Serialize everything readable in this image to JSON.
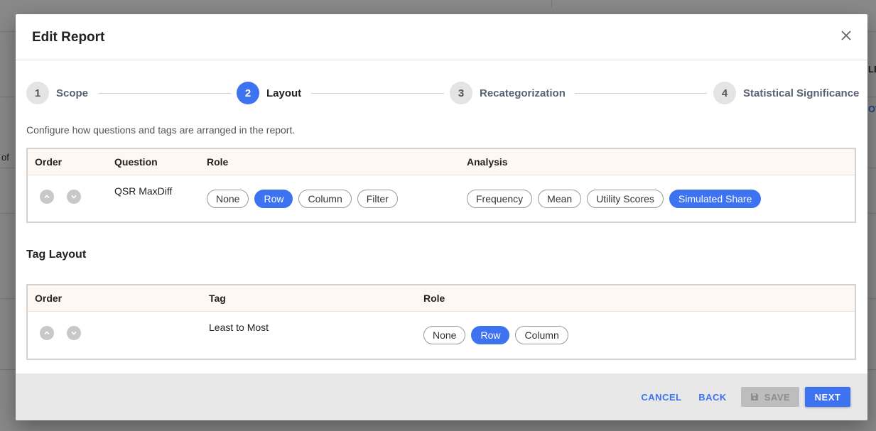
{
  "background": {
    "text_of": "of",
    "text_le": "LE",
    "text_ow": "OW"
  },
  "dialog": {
    "title": "Edit Report",
    "close_icon": "close-icon"
  },
  "stepper": {
    "steps": [
      {
        "number": "1",
        "label": "Scope",
        "active": false
      },
      {
        "number": "2",
        "label": "Layout",
        "active": true
      },
      {
        "number": "3",
        "label": "Recategorization",
        "active": false
      },
      {
        "number": "4",
        "label": "Statistical Significance",
        "active": false
      }
    ]
  },
  "description": "Configure how questions and tags are arranged in the report.",
  "question_table": {
    "headers": {
      "order": "Order",
      "question": "Question",
      "role": "Role",
      "analysis": "Analysis"
    },
    "rows": [
      {
        "question": "QSR MaxDiff",
        "roles": [
          "None",
          "Row",
          "Column",
          "Filter"
        ],
        "selected_role": "Row",
        "analyses": [
          "Frequency",
          "Mean",
          "Utility Scores",
          "Simulated Share"
        ],
        "selected_analysis": "Simulated Share"
      }
    ]
  },
  "tag_layout": {
    "title": "Tag Layout",
    "headers": {
      "order": "Order",
      "tag": "Tag",
      "role": "Role"
    },
    "rows": [
      {
        "tag": "Least to Most",
        "roles": [
          "None",
          "Row",
          "Column"
        ],
        "selected_role": "Row"
      }
    ]
  },
  "footer": {
    "cancel": "CANCEL",
    "back": "BACK",
    "save": "SAVE",
    "next": "NEXT"
  },
  "colors": {
    "accent": "#3d73f0",
    "header_bg": "#fff8f2",
    "footer_bg": "#e8e8e8"
  }
}
